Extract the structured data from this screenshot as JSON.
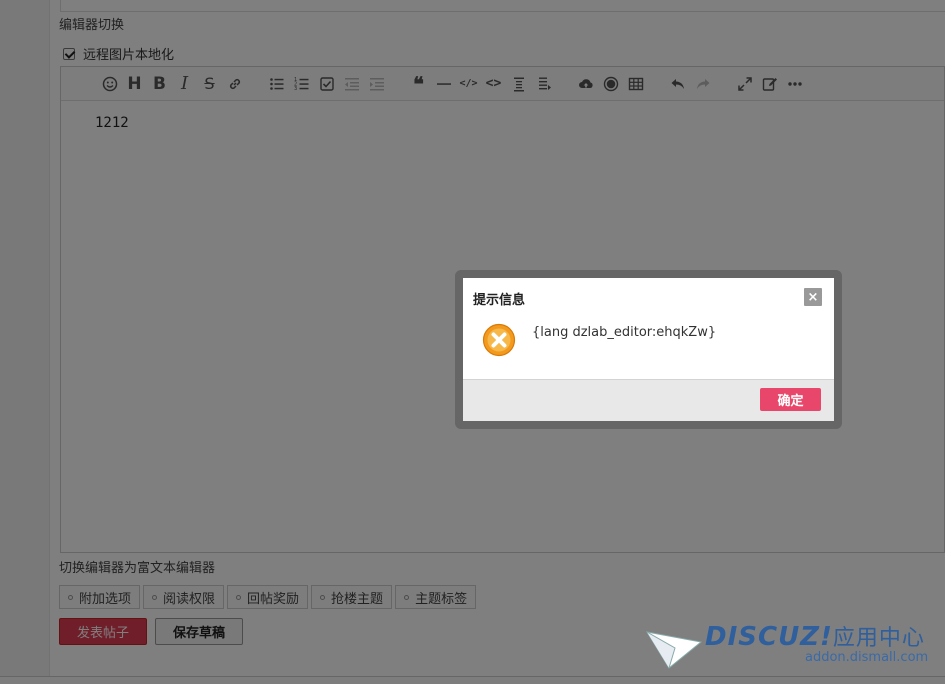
{
  "page": {
    "switch_label": "编辑器切换",
    "remote_image_label": "远程图片本地化",
    "below_label": "切换编辑器为富文本编辑器"
  },
  "editor": {
    "content": "1212",
    "toolbar_icons": [
      "emoji-icon",
      "heading-icon",
      "bold-icon",
      "italic-icon",
      "strikethrough-icon",
      "link-icon",
      "bullet-list-icon",
      "ordered-list-icon",
      "checklist-icon",
      "outdent-icon",
      "indent-icon",
      "quote-icon",
      "horizontal-rule-icon",
      "inline-code-icon",
      "code-block-icon",
      "insert-before-icon",
      "insert-after-icon",
      "upload-icon",
      "record-icon",
      "table-icon",
      "undo-icon",
      "redo-icon",
      "fullscreen-icon",
      "edit-icon",
      "more-icon"
    ]
  },
  "options": [
    {
      "label": "附加选项"
    },
    {
      "label": "阅读权限"
    },
    {
      "label": "回帖奖励"
    },
    {
      "label": "抢楼主题"
    },
    {
      "label": "主题标签"
    }
  ],
  "actions": {
    "post_label": "发表帖子",
    "draft_label": "保存草稿"
  },
  "dialog": {
    "title": "提示信息",
    "close_label": "×",
    "message": "{lang dzlab_editor:ehqkZw}",
    "ok_label": "确定"
  },
  "watermark": {
    "brand": "DISCUZ!",
    "suffix": "应用中心",
    "url": "addon.dismall.com"
  },
  "colors": {
    "primary_red": "#e03d55",
    "dialog_ok": "#e8476b",
    "error_icon": "#f39a1e",
    "watermark_blue": "#2f5f9c"
  }
}
